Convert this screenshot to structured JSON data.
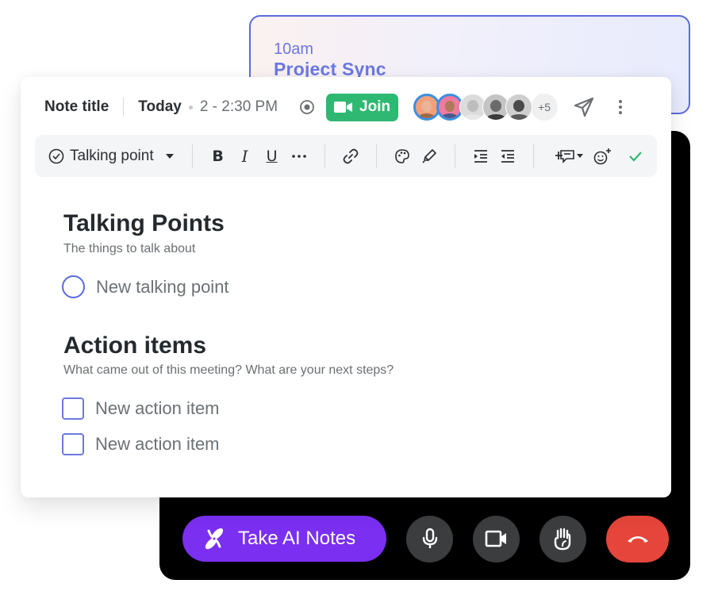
{
  "calendar_event": {
    "time": "10am",
    "title": "Project Sync"
  },
  "note": {
    "header": {
      "title": "Note title",
      "date": "Today",
      "time_range": "2 - 2:30 PM",
      "join_label": "Join",
      "attendees": [
        {
          "name": "attendee-1",
          "highlighted": true,
          "bg": "#f2a07a"
        },
        {
          "name": "attendee-2",
          "highlighted": true,
          "bg": "#f07aa0"
        },
        {
          "name": "attendee-3",
          "highlighted": false,
          "bg": "#d6d6d6"
        },
        {
          "name": "attendee-4",
          "highlighted": false,
          "bg": "#bdbdbd"
        },
        {
          "name": "attendee-5",
          "highlighted": false,
          "bg": "#c9c9c9"
        }
      ],
      "more_attendees": "+5"
    },
    "toolbar": {
      "block_type": "Talking point",
      "buttons": [
        "bold",
        "italic",
        "underline",
        "more",
        "link",
        "color",
        "highlight",
        "indent",
        "outdent",
        "insert-comment",
        "add-reaction",
        "done"
      ],
      "bold_label": "B",
      "italic_label": "I",
      "underline_label": "U"
    },
    "sections": [
      {
        "title": "Talking Points",
        "subtitle": "The things to talk about",
        "items": [
          {
            "type": "radio",
            "text": "New talking point"
          }
        ]
      },
      {
        "title": "Action items",
        "subtitle": "What came out of this meeting? What are your next steps?",
        "items": [
          {
            "type": "checkbox",
            "text": "New action item"
          },
          {
            "type": "checkbox",
            "text": "New action item"
          }
        ]
      }
    ]
  },
  "call_controls": {
    "ai_notes_label": "Take AI Notes",
    "colors": {
      "ai_button": "#7a2ff1",
      "control_button": "#3b3d3f",
      "hangup": "#e5453a"
    }
  },
  "colors": {
    "accent": "#5b6bdc",
    "join": "#2eb872",
    "done_check": "#2eb872"
  }
}
